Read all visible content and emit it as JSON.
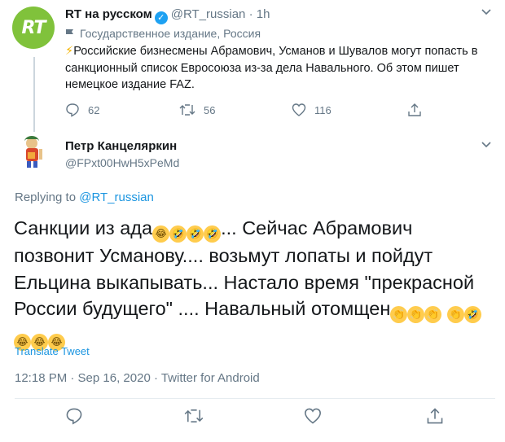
{
  "tweet": {
    "author_name": "RT на русском",
    "handle": "@RT_russian",
    "time": "· 1h",
    "avatar_text": "RT",
    "state_label": "Государственное издание, Россия",
    "text": "Российские бизнесмены Абрамович, Усманов и Шувалов могут попасть в санкционный список Евросоюза из-за дела Навального. Об этом пишет немецкое издание FAZ.",
    "counts": {
      "replies": "62",
      "retweets": "56",
      "likes": "116"
    }
  },
  "reply": {
    "author_name": "Петр Канцеляркин",
    "handle": "@FPxt00HwH5xPeMd",
    "replying_prefix": "Replying to",
    "replying_handle": "@RT_russian",
    "text_part1": "Санкции из ада",
    "text_part2": "... Сейчас Абрамович позвонит Усманову.... возьмут лопаты и пойдут Ельцина выкапывать... Настало время \"прекрасной России будущего\" .... Навальный отомщен",
    "translate_label": "Translate Tweet",
    "timestamp": "12:18 PM · Sep 16, 2020 · Twitter for Android"
  },
  "colors": {
    "accent": "#1b95e0",
    "muted": "#657786",
    "rt_green": "#80c23b",
    "verified": "#1da1f2"
  }
}
